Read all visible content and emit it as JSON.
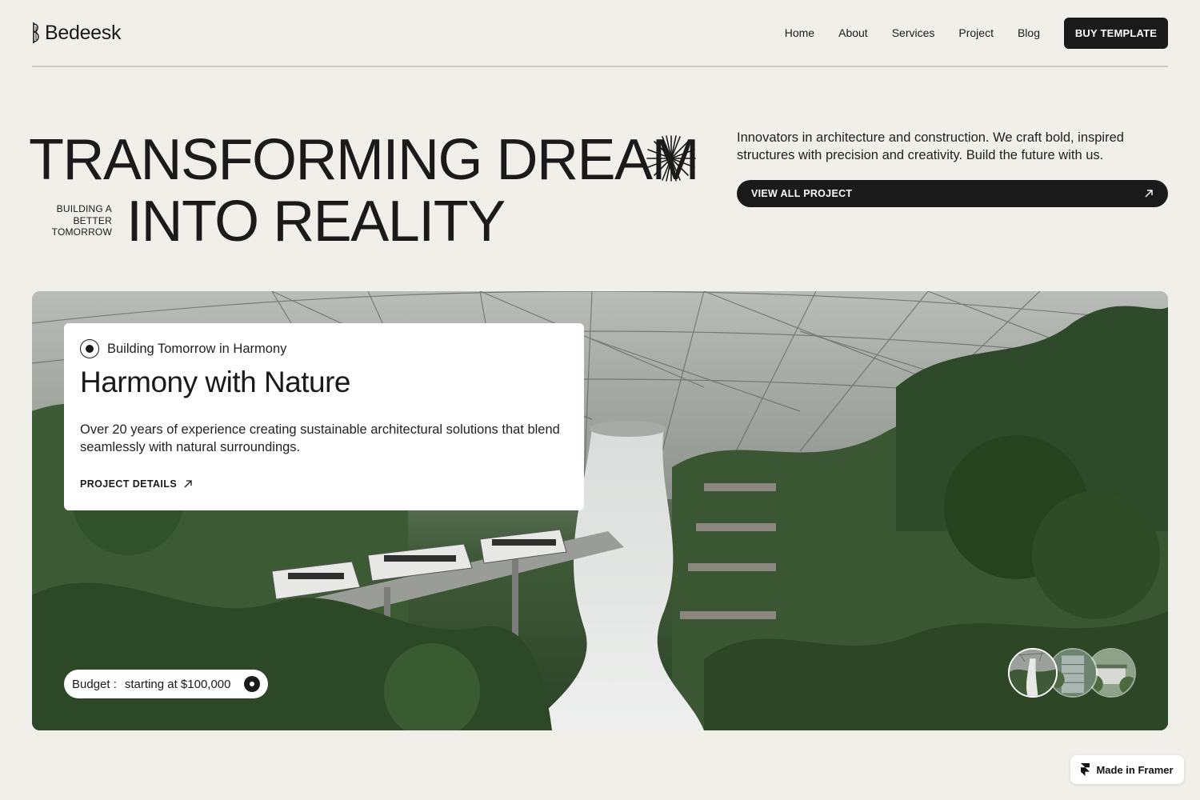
{
  "brand": {
    "name": "Bedeesk",
    "logo_icon": "bedeesk-logo-mark"
  },
  "nav": {
    "items": [
      {
        "label": "Home"
      },
      {
        "label": "About"
      },
      {
        "label": "Services"
      },
      {
        "label": "Project"
      },
      {
        "label": "Blog"
      }
    ],
    "cta_label": "BUY TEMPLATE"
  },
  "hero": {
    "headline_line1": "TRANSFORMING DREAM",
    "headline_line2": "INTO REALITY",
    "tagline_lines": [
      "BUILDING A",
      "BETTER",
      "TOMORROW"
    ],
    "decoration_icon": "starburst-icon",
    "intro": "Innovators in architecture and construction. We craft bold, inspired structures with precision and creativity. Build the future with us.",
    "view_all_label": "VIEW ALL PROJECT"
  },
  "feature": {
    "image_subject": "Indoor rain vortex waterfall under glass dome with forest and skytrain",
    "eyebrow": "Building Tomorrow in Harmony",
    "title": "Harmony with Nature",
    "description": "Over 20 years of experience creating sustainable architectural solutions that blend seamlessly with natural surroundings.",
    "details_label": "PROJECT DETAILS",
    "budget_label": "Budget :",
    "budget_value": "starting at $100,000",
    "thumbnails": [
      {
        "name": "waterfall-dome",
        "active": true
      },
      {
        "name": "glass-building",
        "active": false
      },
      {
        "name": "villa-garden",
        "active": false
      }
    ]
  },
  "badge": {
    "label": "Made in Framer",
    "icon": "framer-icon"
  },
  "colors": {
    "background": "#f0efea",
    "ink": "#1a1a1a",
    "card": "#ffffff",
    "foliage": "#3f5a38"
  }
}
